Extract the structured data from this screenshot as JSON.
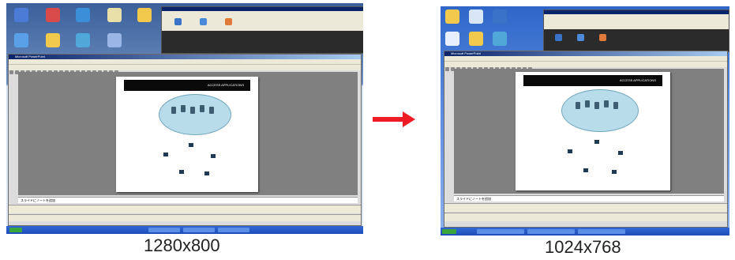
{
  "left": {
    "caption": "1280x800",
    "window_title": "Microsoft PowerPoint",
    "slide_title": "ACCESS APPLICATIONS",
    "notes_text": "スライドにノートを追加"
  },
  "right": {
    "caption": "1024x768",
    "window_title": "Microsoft PowerPoint",
    "slide_title": "ACCESS APPLICATIONS",
    "notes_text": "スライドにノートを追加"
  },
  "colors": {
    "arrow": "#ee1c24",
    "taskbar": "#1c4db8",
    "slide_header": "#0a0a0a",
    "cloud": "#b9dcea",
    "canvas_gray": "#808080"
  },
  "icons": [
    "desktop-icon",
    "arrow-right-icon",
    "server-icon",
    "laptop-icon",
    "router-icon"
  ]
}
